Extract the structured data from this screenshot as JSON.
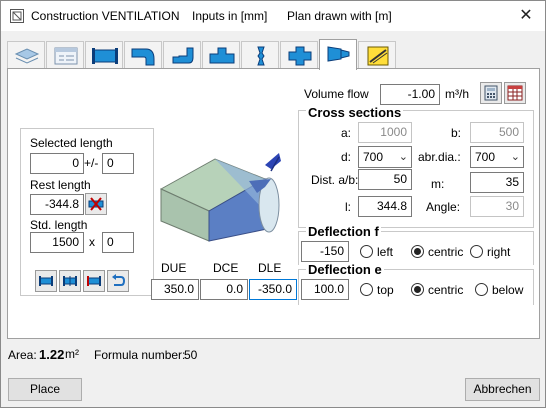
{
  "window": {
    "title_name": "Construction VENTILATION",
    "title_inputs": "Inputs in [mm]",
    "title_plan": "Plan drawn with  [m]",
    "close_glyph": "✕"
  },
  "tabs": [
    {
      "icon": "layers-icon"
    },
    {
      "icon": "form-list-icon"
    },
    {
      "icon": "straight-duct-icon"
    },
    {
      "icon": "bend-icon"
    },
    {
      "icon": "offset-icon"
    },
    {
      "icon": "tee-icon"
    },
    {
      "icon": "reducer-icon"
    },
    {
      "icon": "cross-icon"
    },
    {
      "icon": "transition-icon",
      "active": true
    },
    {
      "icon": "diagonal-element-icon"
    }
  ],
  "left_group": {
    "selected_length_label": "Selected length",
    "selected_length_value": "0",
    "plus_minus": "+/-",
    "tolerance_value": "0",
    "rest_length_label": "Rest length",
    "rest_length_value": "-344.8",
    "std_length_label": "Std. length",
    "std_length_value": "1500",
    "times": "x",
    "count_value": "0"
  },
  "dims": {
    "due_label": "DUE",
    "dce_label": "DCE",
    "dle_label": "DLE",
    "due_value": "350.0",
    "dce_value": "0.0",
    "dle_value": "-350.0"
  },
  "volume_flow": {
    "label": "Volume flow",
    "value": "-1.00",
    "unit": "m³/h"
  },
  "cross_sections": {
    "heading": "Cross sections",
    "a_label": "a:",
    "a_value": "1000",
    "b_label": "b:",
    "b_value": "500",
    "d_label": "d:",
    "d_value": "700",
    "abr_label": "abr.dia.:",
    "abr_value": "700",
    "dist_label": "Dist. a/b:",
    "dist_value": "50",
    "m_label": "m:",
    "m_value": "35",
    "l_label": "l:",
    "l_value": "344.8",
    "angle_label": "Angle:",
    "angle_value": "30"
  },
  "deflection_f": {
    "heading": "Deflection f",
    "value": "-150",
    "options": [
      "left",
      "centric",
      "right"
    ],
    "selected": "centric"
  },
  "deflection_e": {
    "heading": "Deflection e",
    "value": "100.0",
    "options": [
      "top",
      "centric",
      "below"
    ],
    "selected": "centric"
  },
  "footer": {
    "area_label": "Area:",
    "area_value": "1.22",
    "area_unit": "m²",
    "formula_label": "Formula number:",
    "formula_value": "50",
    "place_label": "Place",
    "cancel_label": "Abbrechen"
  }
}
